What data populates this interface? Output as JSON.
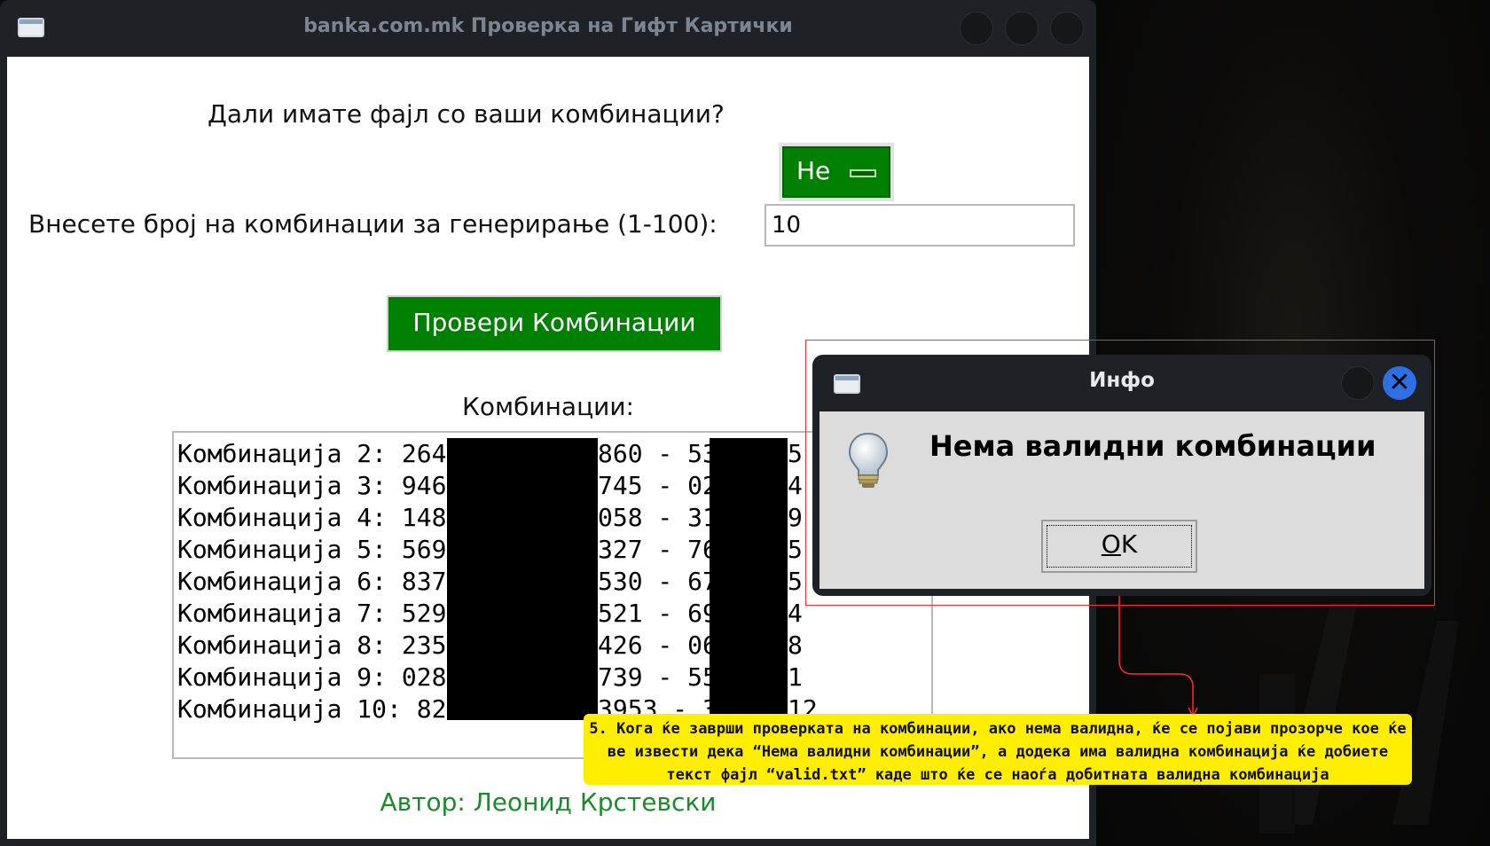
{
  "main_window": {
    "title": "banka.com.mk Проверка на Гифт Картички",
    "file_question": "Дали имате фајл со ваши комбинации?",
    "file_toggle_label": "Не",
    "count_label": "Внесете број на комбинации за генерирање (1-100):",
    "count_value": "10",
    "check_button": "Провери Комбинации",
    "combinations_label": "Комбинации:",
    "combinations": [
      {
        "prefix": "Комбинација 2: 264",
        "middle": "860 - 53",
        "suffix": "5"
      },
      {
        "prefix": "Комбинација 3: 946",
        "middle": "745 - 02",
        "suffix": "4"
      },
      {
        "prefix": "Комбинација 4: 148",
        "middle": "058 - 31",
        "suffix": "9"
      },
      {
        "prefix": "Комбинација 5: 569",
        "middle": "327 - 76",
        "suffix": "5"
      },
      {
        "prefix": "Комбинација 6: 837",
        "middle": "530 - 67",
        "suffix": "5"
      },
      {
        "prefix": "Комбинација 7: 529",
        "middle": "521 - 69",
        "suffix": "4"
      },
      {
        "prefix": "Комбинација 8: 235",
        "middle": "426 - 06",
        "suffix": "8"
      },
      {
        "prefix": "Комбинација 9: 028",
        "middle": "739 - 55",
        "suffix": "1"
      },
      {
        "prefix": "Комбинација 10: 82",
        "middle": "3953 - 3",
        "suffix": "12"
      }
    ],
    "author": "Автор: Леонид Крстевски"
  },
  "dialog": {
    "title": "Инфо",
    "message": "Нема валидни комбинации",
    "ok_button": "OK",
    "ok_mnemonic": "O",
    "ok_rest": "K"
  },
  "annotation": {
    "text": "5. Кога ќе заврши проверката на комбинации, ако нема валидна, ќе се појави прозорче кое ќе ве извести дека “Нема валидни комбинации”, а додека има валидна комбинација ќе добиете текст фајл “valid.txt” каде што ќе се наоѓа добитната валидна комбинација",
    "highlight_color": "#ff2a2a",
    "note_color": "#ffee00"
  },
  "colors": {
    "accent_green": "#008000",
    "author_green": "#1b8a2a",
    "close_blue": "#2f6fe4"
  },
  "icons": [
    "window-icon",
    "lightbulb-icon",
    "close-icon"
  ]
}
